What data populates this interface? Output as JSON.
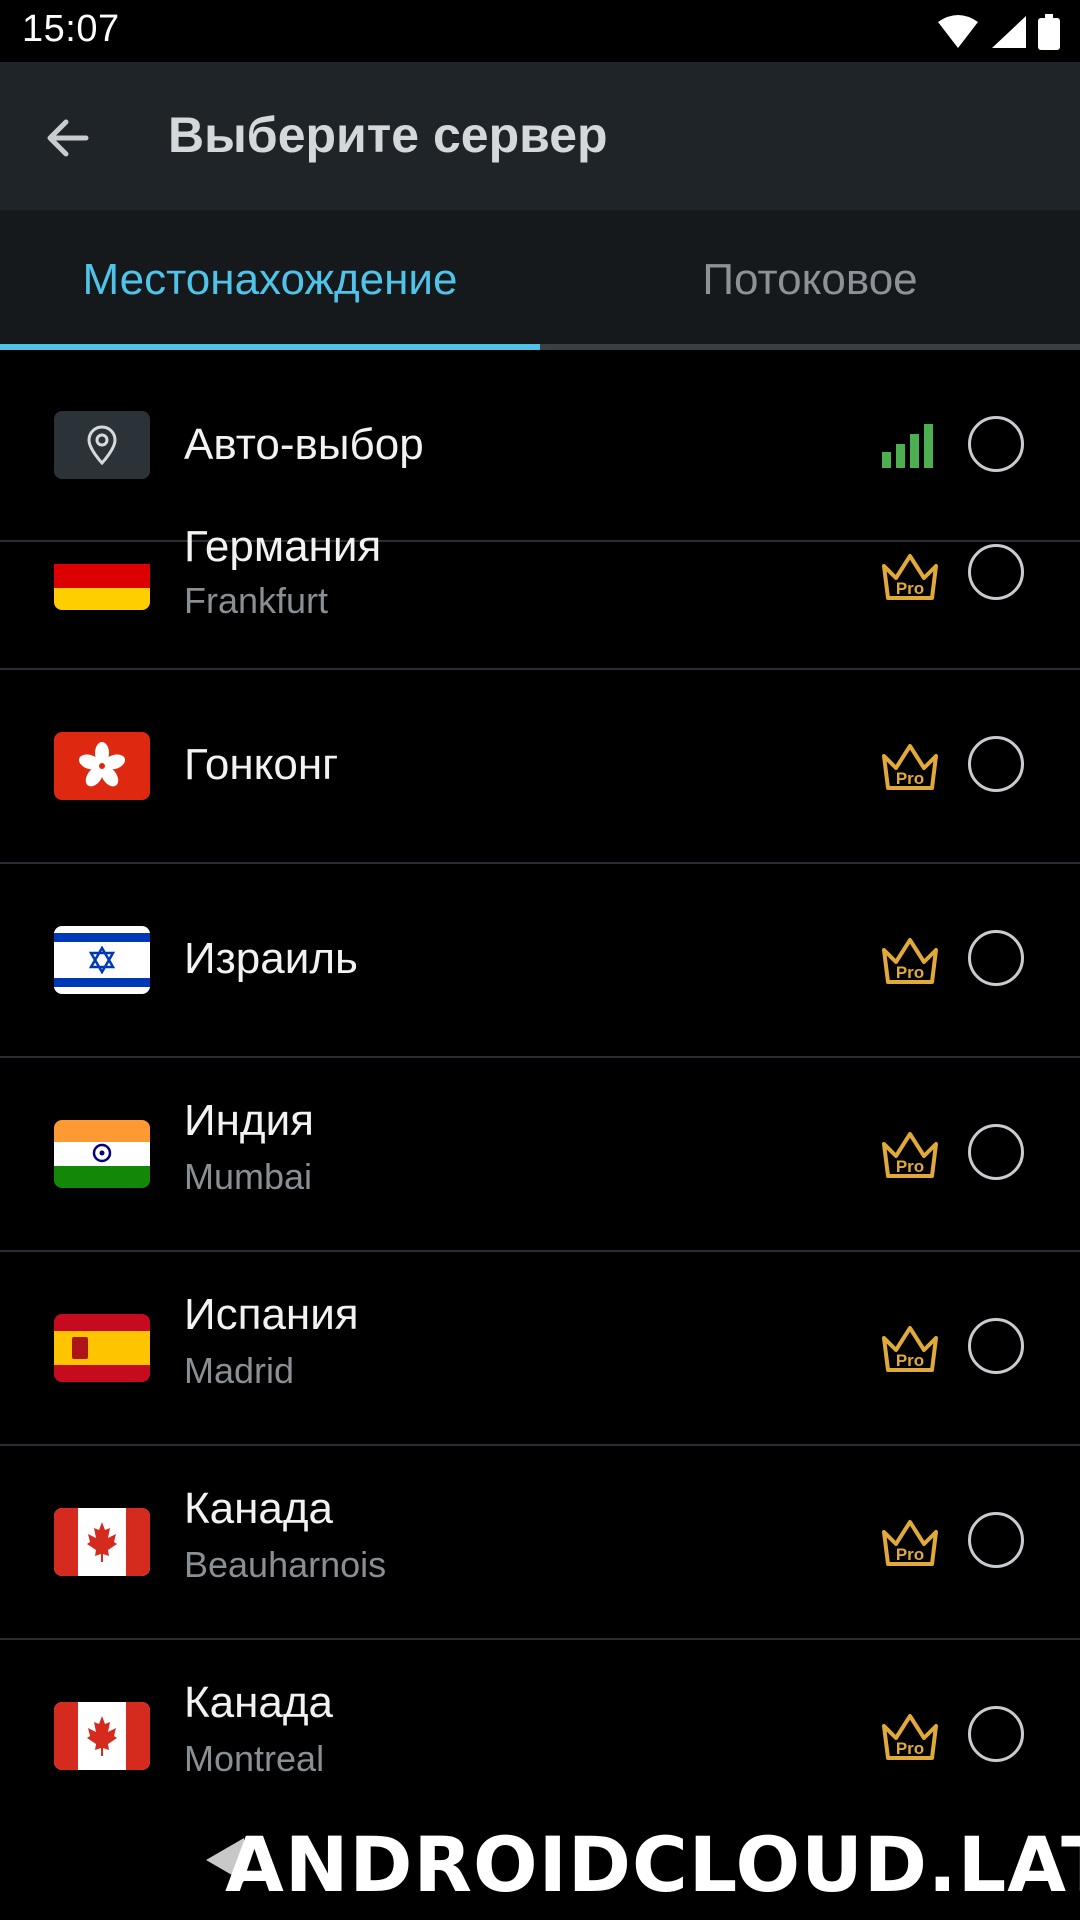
{
  "status_bar": {
    "time": "15:07"
  },
  "app_bar": {
    "title": "Выберите сервер"
  },
  "tabs": [
    {
      "label": "Местонахождение",
      "active": true
    },
    {
      "label": "Потоковое",
      "active": false
    }
  ],
  "auto_select": {
    "label": "Авто-выбор",
    "signal": "signal-bars-icon"
  },
  "servers": [
    {
      "country": "Германия",
      "city": "Frankfurt",
      "flag": "germany",
      "badge": "Pro"
    },
    {
      "country": "Гонконг",
      "city": "",
      "flag": "hong-kong",
      "badge": "Pro"
    },
    {
      "country": "Израиль",
      "city": "",
      "flag": "israel",
      "badge": "Pro"
    },
    {
      "country": "Индия",
      "city": "Mumbai",
      "flag": "india",
      "badge": "Pro"
    },
    {
      "country": "Испания",
      "city": "Madrid",
      "flag": "spain",
      "badge": "Pro"
    },
    {
      "country": "Канада",
      "city": "Beauharnois",
      "flag": "canada",
      "badge": "Pro"
    },
    {
      "country": "Канада",
      "city": "Montreal",
      "flag": "canada",
      "badge": "Pro"
    }
  ],
  "watermark": "ANDROIDCLOUD.LAT",
  "colors": {
    "accent": "#4fc3e8",
    "pro_gold": "#e0a93a",
    "signal_green": "#4caf50"
  }
}
